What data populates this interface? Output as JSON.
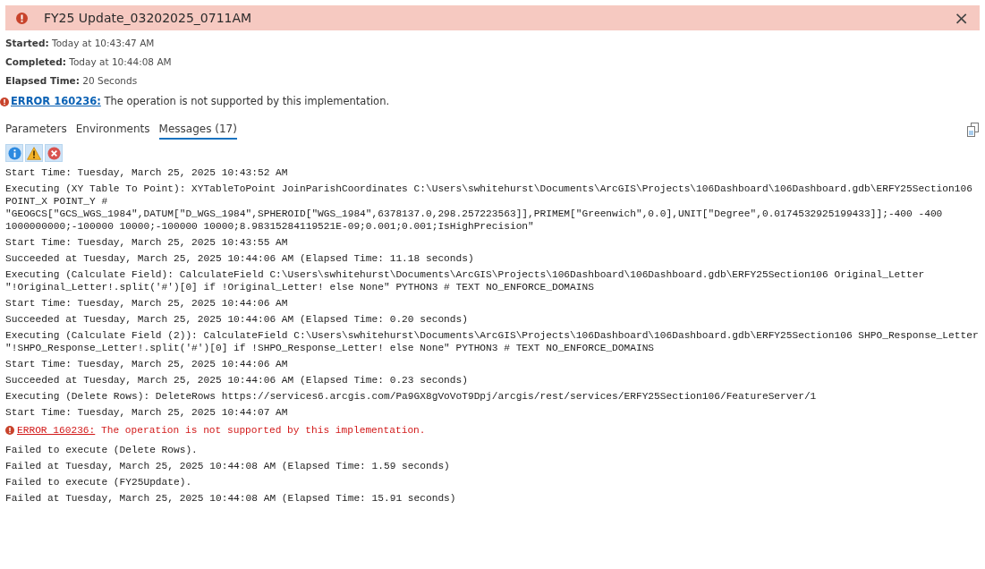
{
  "header": {
    "title": "FY25 Update_03202025_0711AM",
    "kind": "error",
    "close": "×"
  },
  "details": [
    {
      "label": "Started:",
      "value": "Today at 10:43:47 AM"
    },
    {
      "label": "Completed:",
      "value": "Today at 10:44:08 AM"
    },
    {
      "label": "Elapsed Time:",
      "value": "20 Seconds"
    }
  ],
  "error": {
    "code": "ERROR 160236:",
    "text": "The operation is not supported by this implementation."
  },
  "tabs": [
    {
      "label": "Parameters",
      "selected": false
    },
    {
      "label": "Environments",
      "selected": false
    },
    {
      "label": "Messages (17)",
      "selected": true
    }
  ],
  "filters": [
    {
      "kind": "info",
      "on": true
    },
    {
      "kind": "warning",
      "on": true
    },
    {
      "kind": "error",
      "on": true
    }
  ],
  "messages": [
    {
      "kind": "info",
      "lines": [
        "Start Time: Tuesday, March 25, 2025 10:43:52 AM"
      ]
    },
    {
      "kind": "info",
      "lines": [
        "Executing (XY Table To Point): XYTableToPoint JoinParishCoordinates C:\\Users\\swhitehurst\\Documents\\ArcGIS\\Projects\\106Dashboard\\106Dashboard.gdb\\ERFY25Section106",
        "POINT_X POINT_Y #",
        "\"GEOGCS[\"GCS_WGS_1984\",DATUM[\"D_WGS_1984\",SPHEROID[\"WGS_1984\",6378137.0,298.257223563]],PRIMEM[\"Greenwich\",0.0],UNIT[\"Degree\",0.0174532925199433]];-400 -400",
        "1000000000;-100000 10000;-100000 10000;8.98315284119521E-09;0.001;0.001;IsHighPrecision\""
      ]
    },
    {
      "kind": "info",
      "lines": [
        "Start Time: Tuesday, March 25, 2025 10:43:55 AM"
      ]
    },
    {
      "kind": "info",
      "lines": [
        "Succeeded at Tuesday, March 25, 2025 10:44:06 AM (Elapsed Time: 11.18 seconds)"
      ]
    },
    {
      "kind": "info",
      "lines": [
        "Executing (Calculate Field): CalculateField C:\\Users\\swhitehurst\\Documents\\ArcGIS\\Projects\\106Dashboard\\106Dashboard.gdb\\ERFY25Section106 Original_Letter",
        "\"!Original_Letter!.split('#')[0] if !Original_Letter! else None\" PYTHON3 # TEXT NO_ENFORCE_DOMAINS"
      ]
    },
    {
      "kind": "info",
      "lines": [
        "Start Time: Tuesday, March 25, 2025 10:44:06 AM"
      ]
    },
    {
      "kind": "info",
      "lines": [
        "Succeeded at Tuesday, March 25, 2025 10:44:06 AM (Elapsed Time: 0.20 seconds)"
      ]
    },
    {
      "kind": "info",
      "lines": [
        "Executing (Calculate Field (2)): CalculateField C:\\Users\\swhitehurst\\Documents\\ArcGIS\\Projects\\106Dashboard\\106Dashboard.gdb\\ERFY25Section106 SHPO_Response_Letter",
        "\"!SHPO_Response_Letter!.split('#')[0] if !SHPO_Response_Letter! else None\" PYTHON3 # TEXT NO_ENFORCE_DOMAINS"
      ]
    },
    {
      "kind": "info",
      "lines": [
        "Start Time: Tuesday, March 25, 2025 10:44:06 AM"
      ]
    },
    {
      "kind": "info",
      "lines": [
        "Succeeded at Tuesday, March 25, 2025 10:44:06 AM (Elapsed Time: 0.23 seconds)"
      ]
    },
    {
      "kind": "info",
      "lines": [
        "Executing (Delete Rows): DeleteRows https://services6.arcgis.com/Pa9GX8gVoVoT9Dpj/arcgis/rest/services/ERFY25Section106/FeatureServer/1"
      ]
    },
    {
      "kind": "info",
      "lines": [
        "Start Time: Tuesday, March 25, 2025 10:44:07 AM"
      ]
    },
    {
      "kind": "error",
      "code": "ERROR 160236:",
      "lines": [
        "The operation is not supported by this implementation."
      ]
    },
    {
      "kind": "info",
      "lines": [
        "Failed to execute (Delete Rows)."
      ]
    },
    {
      "kind": "info",
      "lines": [
        "Failed at Tuesday, March 25, 2025 10:44:08 AM (Elapsed Time: 1.59 seconds)"
      ]
    },
    {
      "kind": "info",
      "lines": [
        "Failed to execute (FY25Update)."
      ]
    },
    {
      "kind": "info",
      "lines": [
        "Failed at Tuesday, March 25, 2025 10:44:08 AM (Elapsed Time: 15.91 seconds)"
      ]
    }
  ]
}
